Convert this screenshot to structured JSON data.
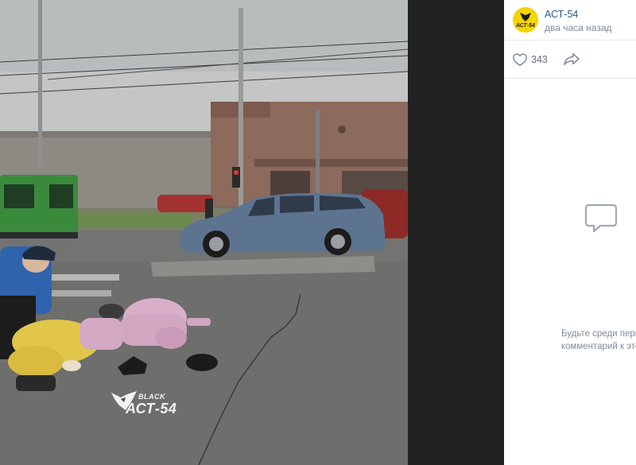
{
  "post": {
    "author": "АСТ-54",
    "time": "два часа назад",
    "avatar_logo_text": "АСТ-54",
    "likes": "343"
  },
  "icons": {
    "like": "heart-icon",
    "share": "share-arrow-icon",
    "empty_comments": "comment-bubble-icon"
  },
  "comments": {
    "empty_line_1": "Будьте среди первых, кто",
    "empty_line_2": "комментарий к этой фото"
  },
  "photo": {
    "watermark_small": "BLACK",
    "watermark_big": "АСТ-54"
  },
  "colors": {
    "background": "#222222",
    "panel": "#ffffff",
    "link": "#2a5885",
    "muted": "#818c99",
    "avatar": "#f5d500"
  }
}
